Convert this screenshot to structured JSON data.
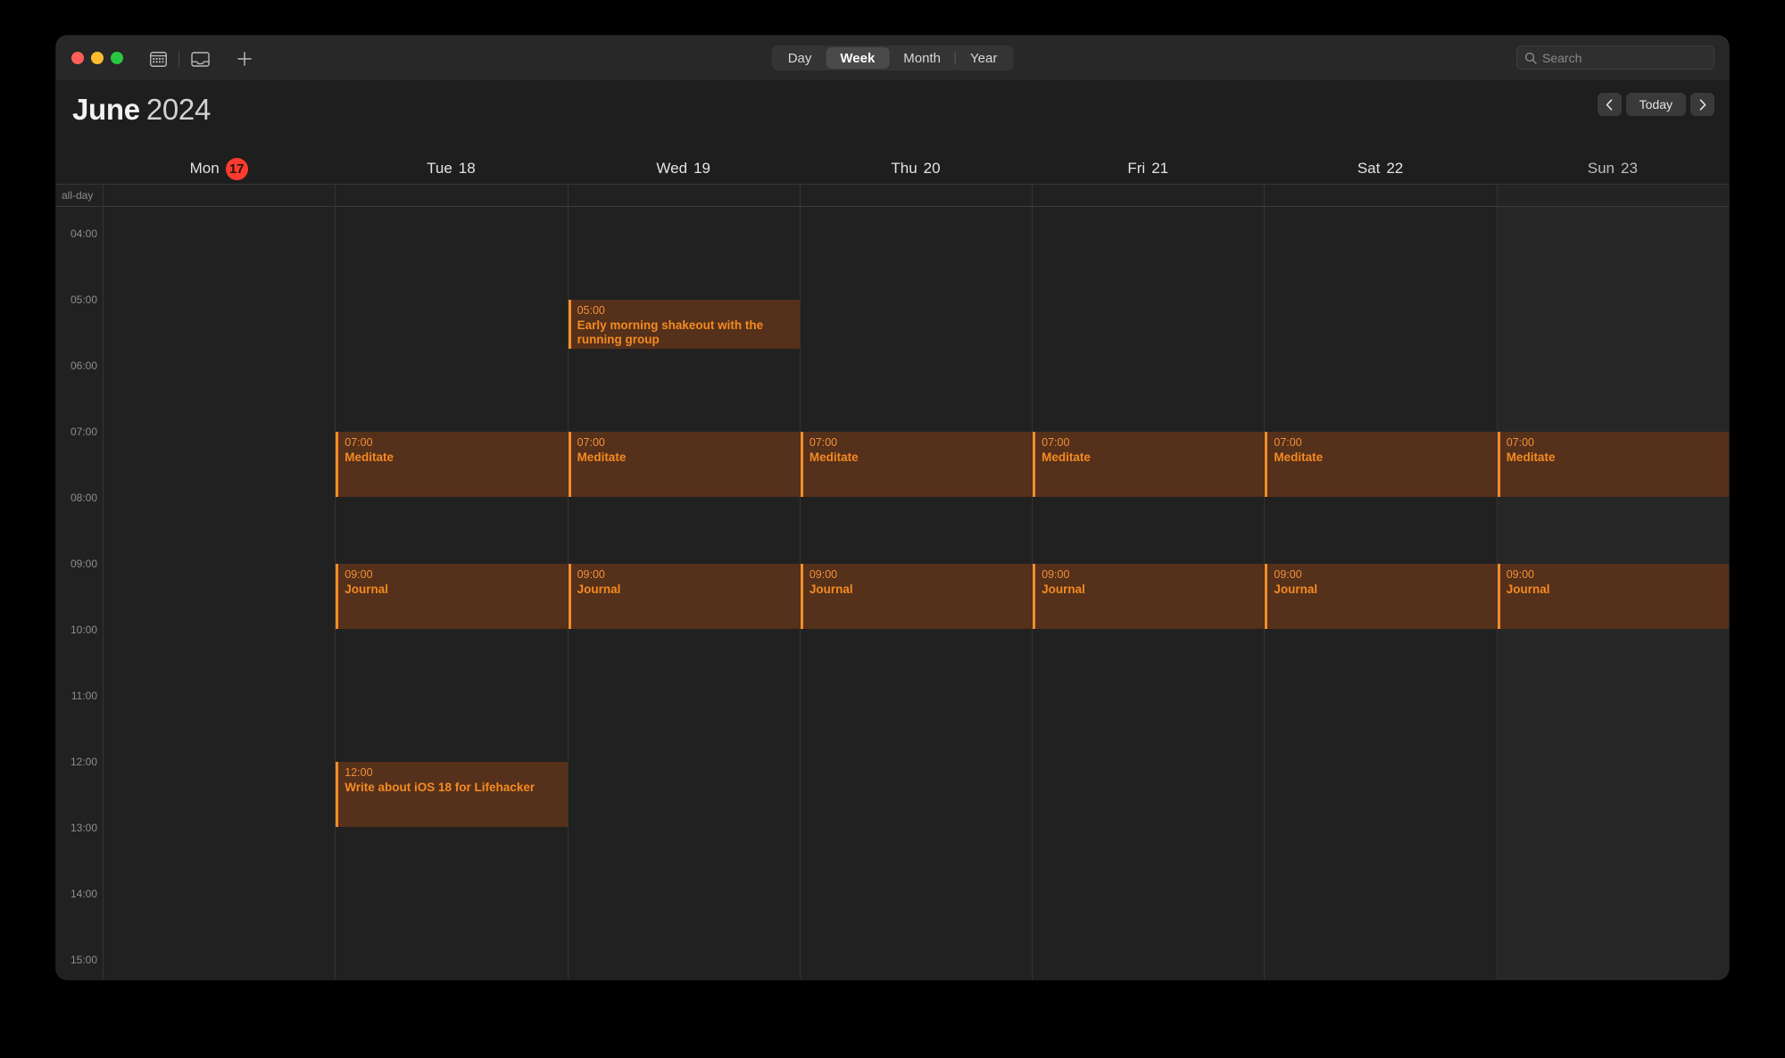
{
  "window": {
    "traffic_lights": [
      "close",
      "minimize",
      "zoom"
    ],
    "toolbar": {
      "calendar_toggle_icon": "calendar-grid-icon",
      "inbox_icon": "inbox-tray-icon",
      "add_icon": "plus-icon"
    },
    "view_modes": [
      {
        "label": "Day",
        "active": false
      },
      {
        "label": "Week",
        "active": true
      },
      {
        "label": "Month",
        "active": false
      },
      {
        "label": "Year",
        "active": false
      }
    ],
    "search": {
      "icon": "search-icon",
      "placeholder": "Search",
      "value": ""
    }
  },
  "header": {
    "month": "June",
    "year": "2024",
    "nav": {
      "prev_icon": "chevron-left-icon",
      "today_label": "Today",
      "next_icon": "chevron-right-icon"
    }
  },
  "calendar": {
    "all_day_label": "all-day",
    "days": [
      {
        "weekday": "Mon",
        "date": "17",
        "is_today": true,
        "dim": false
      },
      {
        "weekday": "Tue",
        "date": "18",
        "is_today": false,
        "dim": false
      },
      {
        "weekday": "Wed",
        "date": "19",
        "is_today": false,
        "dim": false
      },
      {
        "weekday": "Thu",
        "date": "20",
        "is_today": false,
        "dim": false
      },
      {
        "weekday": "Fri",
        "date": "21",
        "is_today": false,
        "dim": false
      },
      {
        "weekday": "Sat",
        "date": "22",
        "is_today": false,
        "dim": false
      },
      {
        "weekday": "Sun",
        "date": "23",
        "is_today": false,
        "dim": true
      }
    ],
    "hour_labels": [
      "04:00",
      "05:00",
      "06:00",
      "07:00",
      "08:00",
      "09:00",
      "10:00",
      "11:00",
      "12:00",
      "13:00",
      "14:00",
      "15:00"
    ],
    "hour_start": 4,
    "hour_end": 15,
    "accent_color": "#ff8c26",
    "event_bg_color": "#55301a",
    "today_color": "#ff3b30",
    "events": [
      {
        "day_index": 2,
        "time": "05:00",
        "title": "Early morning shakeout with the running group",
        "start_hour": 5.0,
        "end_hour": 5.75
      },
      {
        "day_index": 1,
        "time": "07:00",
        "title": "Meditate",
        "start_hour": 7.0,
        "end_hour": 8.0
      },
      {
        "day_index": 2,
        "time": "07:00",
        "title": "Meditate",
        "start_hour": 7.0,
        "end_hour": 8.0
      },
      {
        "day_index": 3,
        "time": "07:00",
        "title": "Meditate",
        "start_hour": 7.0,
        "end_hour": 8.0
      },
      {
        "day_index": 4,
        "time": "07:00",
        "title": "Meditate",
        "start_hour": 7.0,
        "end_hour": 8.0
      },
      {
        "day_index": 5,
        "time": "07:00",
        "title": "Meditate",
        "start_hour": 7.0,
        "end_hour": 8.0
      },
      {
        "day_index": 6,
        "time": "07:00",
        "title": "Meditate",
        "start_hour": 7.0,
        "end_hour": 8.0
      },
      {
        "day_index": 1,
        "time": "09:00",
        "title": "Journal",
        "start_hour": 9.0,
        "end_hour": 10.0
      },
      {
        "day_index": 2,
        "time": "09:00",
        "title": "Journal",
        "start_hour": 9.0,
        "end_hour": 10.0
      },
      {
        "day_index": 3,
        "time": "09:00",
        "title": "Journal",
        "start_hour": 9.0,
        "end_hour": 10.0
      },
      {
        "day_index": 4,
        "time": "09:00",
        "title": "Journal",
        "start_hour": 9.0,
        "end_hour": 10.0
      },
      {
        "day_index": 5,
        "time": "09:00",
        "title": "Journal",
        "start_hour": 9.0,
        "end_hour": 10.0
      },
      {
        "day_index": 6,
        "time": "09:00",
        "title": "Journal",
        "start_hour": 9.0,
        "end_hour": 10.0
      },
      {
        "day_index": 1,
        "time": "12:00",
        "title": "Write about iOS 18 for Lifehacker",
        "start_hour": 12.0,
        "end_hour": 13.0
      }
    ]
  }
}
